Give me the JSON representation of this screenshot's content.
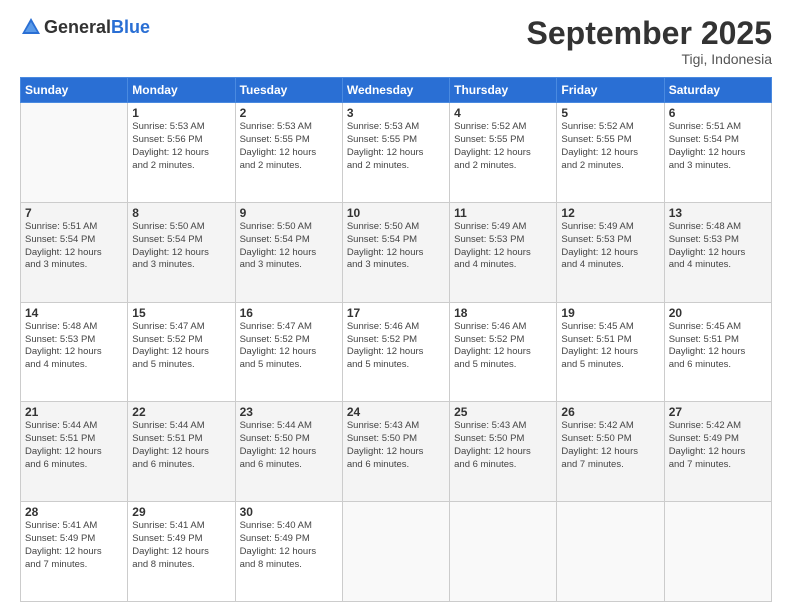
{
  "header": {
    "logo_general": "General",
    "logo_blue": "Blue",
    "month": "September 2025",
    "location": "Tigi, Indonesia"
  },
  "days_of_week": [
    "Sunday",
    "Monday",
    "Tuesday",
    "Wednesday",
    "Thursday",
    "Friday",
    "Saturday"
  ],
  "weeks": [
    [
      {
        "day": "",
        "info": ""
      },
      {
        "day": "1",
        "info": "Sunrise: 5:53 AM\nSunset: 5:56 PM\nDaylight: 12 hours\nand 2 minutes."
      },
      {
        "day": "2",
        "info": "Sunrise: 5:53 AM\nSunset: 5:55 PM\nDaylight: 12 hours\nand 2 minutes."
      },
      {
        "day": "3",
        "info": "Sunrise: 5:53 AM\nSunset: 5:55 PM\nDaylight: 12 hours\nand 2 minutes."
      },
      {
        "day": "4",
        "info": "Sunrise: 5:52 AM\nSunset: 5:55 PM\nDaylight: 12 hours\nand 2 minutes."
      },
      {
        "day": "5",
        "info": "Sunrise: 5:52 AM\nSunset: 5:55 PM\nDaylight: 12 hours\nand 2 minutes."
      },
      {
        "day": "6",
        "info": "Sunrise: 5:51 AM\nSunset: 5:54 PM\nDaylight: 12 hours\nand 3 minutes."
      }
    ],
    [
      {
        "day": "7",
        "info": "Sunrise: 5:51 AM\nSunset: 5:54 PM\nDaylight: 12 hours\nand 3 minutes."
      },
      {
        "day": "8",
        "info": "Sunrise: 5:50 AM\nSunset: 5:54 PM\nDaylight: 12 hours\nand 3 minutes."
      },
      {
        "day": "9",
        "info": "Sunrise: 5:50 AM\nSunset: 5:54 PM\nDaylight: 12 hours\nand 3 minutes."
      },
      {
        "day": "10",
        "info": "Sunrise: 5:50 AM\nSunset: 5:54 PM\nDaylight: 12 hours\nand 3 minutes."
      },
      {
        "day": "11",
        "info": "Sunrise: 5:49 AM\nSunset: 5:53 PM\nDaylight: 12 hours\nand 4 minutes."
      },
      {
        "day": "12",
        "info": "Sunrise: 5:49 AM\nSunset: 5:53 PM\nDaylight: 12 hours\nand 4 minutes."
      },
      {
        "day": "13",
        "info": "Sunrise: 5:48 AM\nSunset: 5:53 PM\nDaylight: 12 hours\nand 4 minutes."
      }
    ],
    [
      {
        "day": "14",
        "info": "Sunrise: 5:48 AM\nSunset: 5:53 PM\nDaylight: 12 hours\nand 4 minutes."
      },
      {
        "day": "15",
        "info": "Sunrise: 5:47 AM\nSunset: 5:52 PM\nDaylight: 12 hours\nand 5 minutes."
      },
      {
        "day": "16",
        "info": "Sunrise: 5:47 AM\nSunset: 5:52 PM\nDaylight: 12 hours\nand 5 minutes."
      },
      {
        "day": "17",
        "info": "Sunrise: 5:46 AM\nSunset: 5:52 PM\nDaylight: 12 hours\nand 5 minutes."
      },
      {
        "day": "18",
        "info": "Sunrise: 5:46 AM\nSunset: 5:52 PM\nDaylight: 12 hours\nand 5 minutes."
      },
      {
        "day": "19",
        "info": "Sunrise: 5:45 AM\nSunset: 5:51 PM\nDaylight: 12 hours\nand 5 minutes."
      },
      {
        "day": "20",
        "info": "Sunrise: 5:45 AM\nSunset: 5:51 PM\nDaylight: 12 hours\nand 6 minutes."
      }
    ],
    [
      {
        "day": "21",
        "info": "Sunrise: 5:44 AM\nSunset: 5:51 PM\nDaylight: 12 hours\nand 6 minutes."
      },
      {
        "day": "22",
        "info": "Sunrise: 5:44 AM\nSunset: 5:51 PM\nDaylight: 12 hours\nand 6 minutes."
      },
      {
        "day": "23",
        "info": "Sunrise: 5:44 AM\nSunset: 5:50 PM\nDaylight: 12 hours\nand 6 minutes."
      },
      {
        "day": "24",
        "info": "Sunrise: 5:43 AM\nSunset: 5:50 PM\nDaylight: 12 hours\nand 6 minutes."
      },
      {
        "day": "25",
        "info": "Sunrise: 5:43 AM\nSunset: 5:50 PM\nDaylight: 12 hours\nand 6 minutes."
      },
      {
        "day": "26",
        "info": "Sunrise: 5:42 AM\nSunset: 5:50 PM\nDaylight: 12 hours\nand 7 minutes."
      },
      {
        "day": "27",
        "info": "Sunrise: 5:42 AM\nSunset: 5:49 PM\nDaylight: 12 hours\nand 7 minutes."
      }
    ],
    [
      {
        "day": "28",
        "info": "Sunrise: 5:41 AM\nSunset: 5:49 PM\nDaylight: 12 hours\nand 7 minutes."
      },
      {
        "day": "29",
        "info": "Sunrise: 5:41 AM\nSunset: 5:49 PM\nDaylight: 12 hours\nand 8 minutes."
      },
      {
        "day": "30",
        "info": "Sunrise: 5:40 AM\nSunset: 5:49 PM\nDaylight: 12 hours\nand 8 minutes."
      },
      {
        "day": "",
        "info": ""
      },
      {
        "day": "",
        "info": ""
      },
      {
        "day": "",
        "info": ""
      },
      {
        "day": "",
        "info": ""
      }
    ]
  ]
}
